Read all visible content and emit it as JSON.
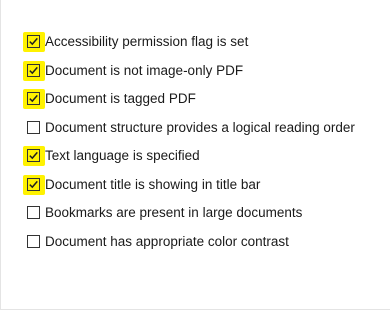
{
  "checklist": {
    "items": [
      {
        "label": "Accessibility permission flag is set",
        "checked": true
      },
      {
        "label": "Document is not image-only PDF",
        "checked": true
      },
      {
        "label": "Document is tagged PDF",
        "checked": true
      },
      {
        "label": "Document structure provides a logical reading order",
        "checked": false
      },
      {
        "label": "Text language is specified",
        "checked": true
      },
      {
        "label": "Document title is showing in title bar",
        "checked": true
      },
      {
        "label": "Bookmarks are present in large documents",
        "checked": false
      },
      {
        "label": "Document has appropriate color contrast",
        "checked": false
      }
    ]
  },
  "colors": {
    "highlight": "#fff200",
    "checkmark": "#1f1f1f"
  }
}
